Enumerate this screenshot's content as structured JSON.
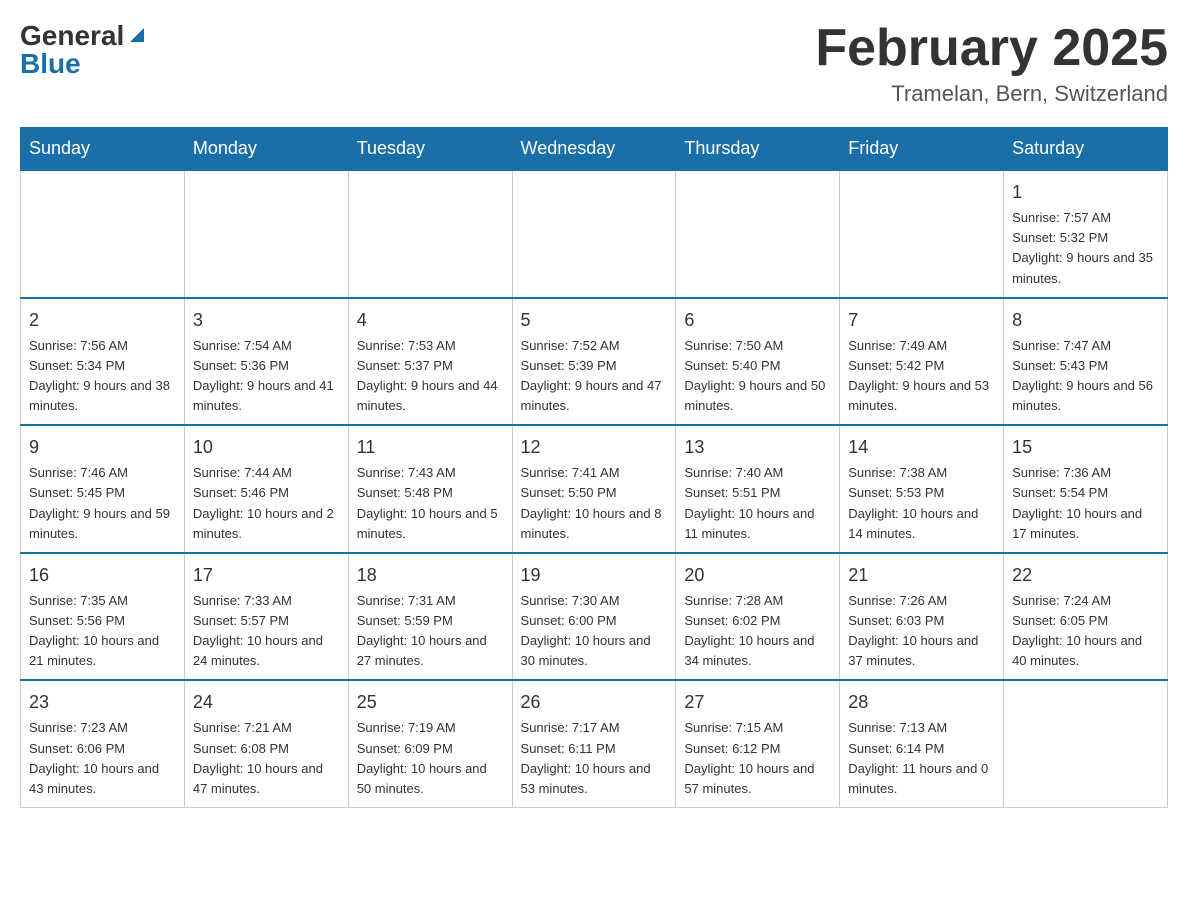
{
  "header": {
    "logo_general": "General",
    "logo_blue": "Blue",
    "month_title": "February 2025",
    "location": "Tramelan, Bern, Switzerland"
  },
  "days_of_week": [
    "Sunday",
    "Monday",
    "Tuesday",
    "Wednesday",
    "Thursday",
    "Friday",
    "Saturday"
  ],
  "weeks": [
    {
      "days": [
        {
          "date": "",
          "info": ""
        },
        {
          "date": "",
          "info": ""
        },
        {
          "date": "",
          "info": ""
        },
        {
          "date": "",
          "info": ""
        },
        {
          "date": "",
          "info": ""
        },
        {
          "date": "",
          "info": ""
        },
        {
          "date": "1",
          "info": "Sunrise: 7:57 AM\nSunset: 5:32 PM\nDaylight: 9 hours and 35 minutes."
        }
      ]
    },
    {
      "days": [
        {
          "date": "2",
          "info": "Sunrise: 7:56 AM\nSunset: 5:34 PM\nDaylight: 9 hours and 38 minutes."
        },
        {
          "date": "3",
          "info": "Sunrise: 7:54 AM\nSunset: 5:36 PM\nDaylight: 9 hours and 41 minutes."
        },
        {
          "date": "4",
          "info": "Sunrise: 7:53 AM\nSunset: 5:37 PM\nDaylight: 9 hours and 44 minutes."
        },
        {
          "date": "5",
          "info": "Sunrise: 7:52 AM\nSunset: 5:39 PM\nDaylight: 9 hours and 47 minutes."
        },
        {
          "date": "6",
          "info": "Sunrise: 7:50 AM\nSunset: 5:40 PM\nDaylight: 9 hours and 50 minutes."
        },
        {
          "date": "7",
          "info": "Sunrise: 7:49 AM\nSunset: 5:42 PM\nDaylight: 9 hours and 53 minutes."
        },
        {
          "date": "8",
          "info": "Sunrise: 7:47 AM\nSunset: 5:43 PM\nDaylight: 9 hours and 56 minutes."
        }
      ]
    },
    {
      "days": [
        {
          "date": "9",
          "info": "Sunrise: 7:46 AM\nSunset: 5:45 PM\nDaylight: 9 hours and 59 minutes."
        },
        {
          "date": "10",
          "info": "Sunrise: 7:44 AM\nSunset: 5:46 PM\nDaylight: 10 hours and 2 minutes."
        },
        {
          "date": "11",
          "info": "Sunrise: 7:43 AM\nSunset: 5:48 PM\nDaylight: 10 hours and 5 minutes."
        },
        {
          "date": "12",
          "info": "Sunrise: 7:41 AM\nSunset: 5:50 PM\nDaylight: 10 hours and 8 minutes."
        },
        {
          "date": "13",
          "info": "Sunrise: 7:40 AM\nSunset: 5:51 PM\nDaylight: 10 hours and 11 minutes."
        },
        {
          "date": "14",
          "info": "Sunrise: 7:38 AM\nSunset: 5:53 PM\nDaylight: 10 hours and 14 minutes."
        },
        {
          "date": "15",
          "info": "Sunrise: 7:36 AM\nSunset: 5:54 PM\nDaylight: 10 hours and 17 minutes."
        }
      ]
    },
    {
      "days": [
        {
          "date": "16",
          "info": "Sunrise: 7:35 AM\nSunset: 5:56 PM\nDaylight: 10 hours and 21 minutes."
        },
        {
          "date": "17",
          "info": "Sunrise: 7:33 AM\nSunset: 5:57 PM\nDaylight: 10 hours and 24 minutes."
        },
        {
          "date": "18",
          "info": "Sunrise: 7:31 AM\nSunset: 5:59 PM\nDaylight: 10 hours and 27 minutes."
        },
        {
          "date": "19",
          "info": "Sunrise: 7:30 AM\nSunset: 6:00 PM\nDaylight: 10 hours and 30 minutes."
        },
        {
          "date": "20",
          "info": "Sunrise: 7:28 AM\nSunset: 6:02 PM\nDaylight: 10 hours and 34 minutes."
        },
        {
          "date": "21",
          "info": "Sunrise: 7:26 AM\nSunset: 6:03 PM\nDaylight: 10 hours and 37 minutes."
        },
        {
          "date": "22",
          "info": "Sunrise: 7:24 AM\nSunset: 6:05 PM\nDaylight: 10 hours and 40 minutes."
        }
      ]
    },
    {
      "days": [
        {
          "date": "23",
          "info": "Sunrise: 7:23 AM\nSunset: 6:06 PM\nDaylight: 10 hours and 43 minutes."
        },
        {
          "date": "24",
          "info": "Sunrise: 7:21 AM\nSunset: 6:08 PM\nDaylight: 10 hours and 47 minutes."
        },
        {
          "date": "25",
          "info": "Sunrise: 7:19 AM\nSunset: 6:09 PM\nDaylight: 10 hours and 50 minutes."
        },
        {
          "date": "26",
          "info": "Sunrise: 7:17 AM\nSunset: 6:11 PM\nDaylight: 10 hours and 53 minutes."
        },
        {
          "date": "27",
          "info": "Sunrise: 7:15 AM\nSunset: 6:12 PM\nDaylight: 10 hours and 57 minutes."
        },
        {
          "date": "28",
          "info": "Sunrise: 7:13 AM\nSunset: 6:14 PM\nDaylight: 11 hours and 0 minutes."
        },
        {
          "date": "",
          "info": ""
        }
      ]
    }
  ]
}
